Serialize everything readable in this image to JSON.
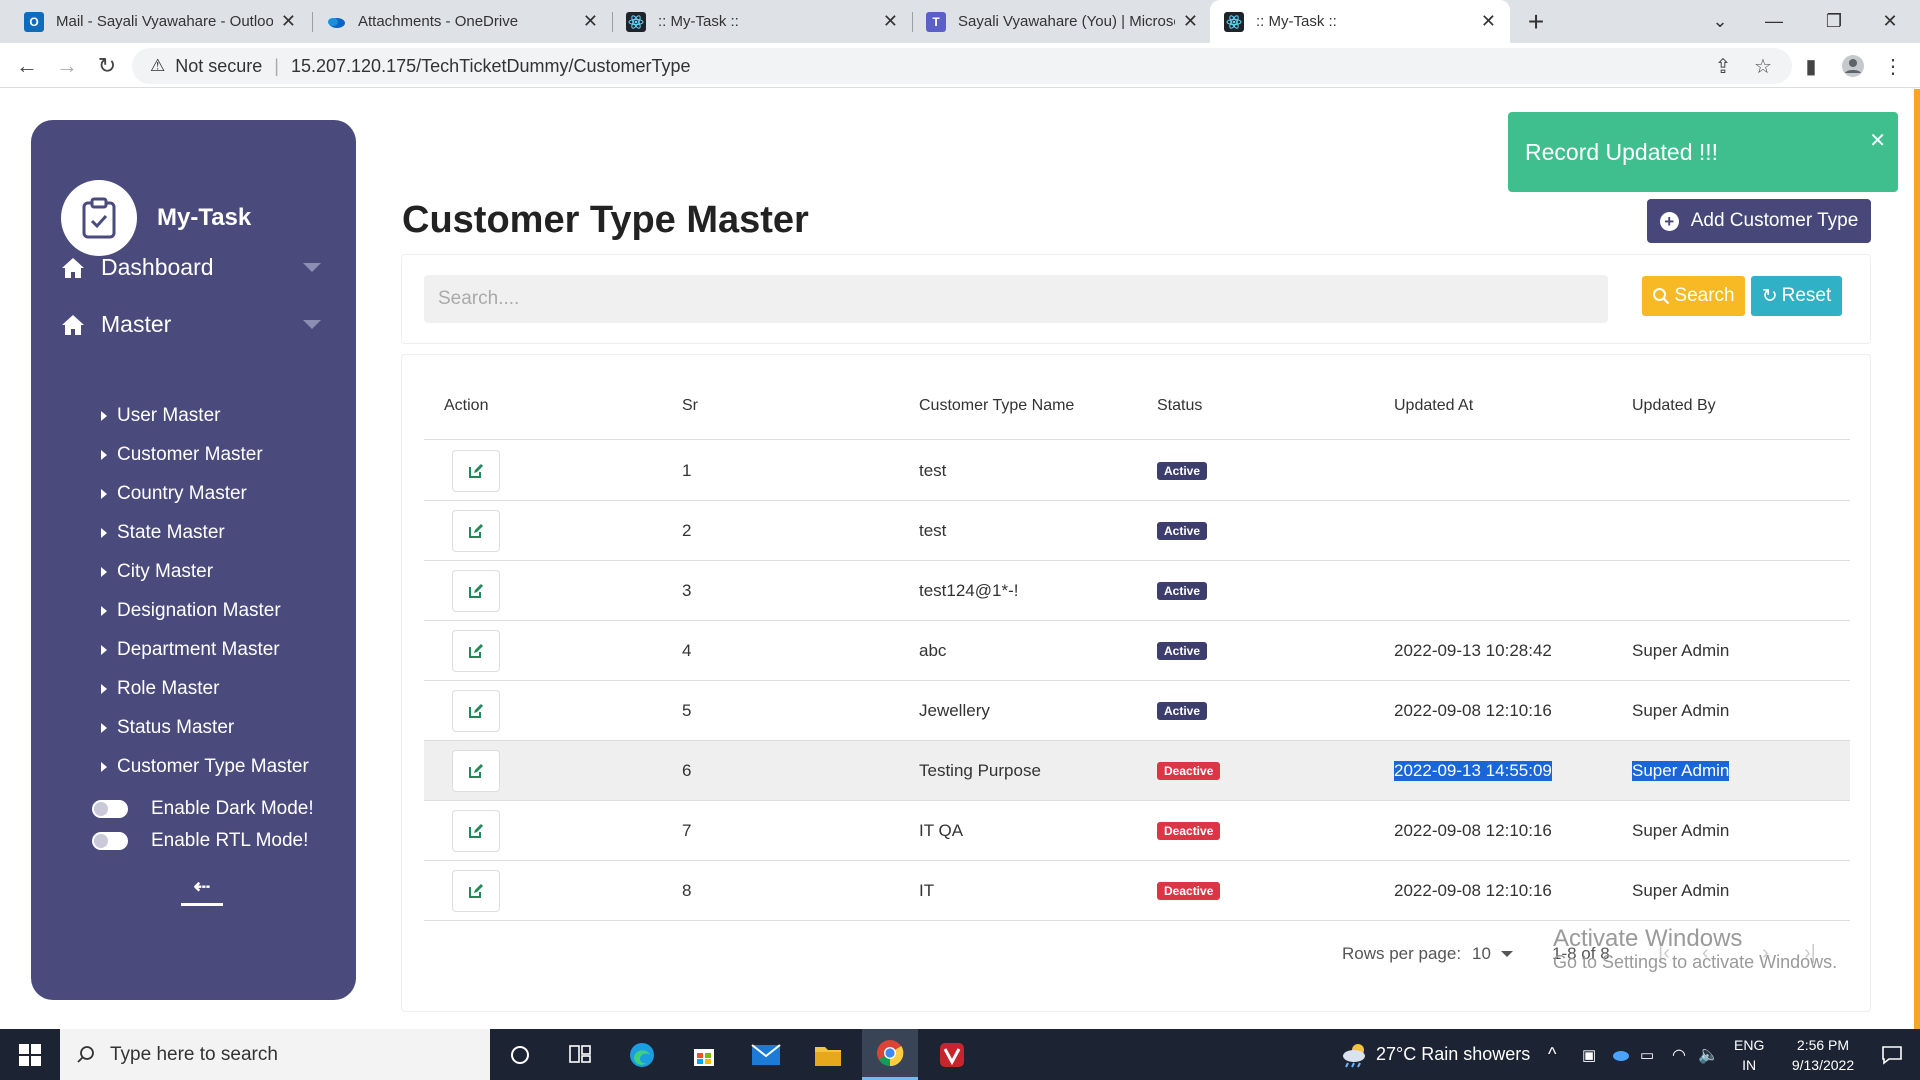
{
  "browser": {
    "tabs": [
      {
        "title": "Mail - Sayali Vyawahare - Outlook",
        "icon": "outlook-icon",
        "color": "#0f6cbd"
      },
      {
        "title": "Attachments - OneDrive",
        "icon": "onedrive-icon",
        "color": "#0a64c8"
      },
      {
        "title": ":: My-Task ::",
        "icon": "react-icon",
        "color": "#20232a"
      },
      {
        "title": "Sayali Vyawahare (You) | Microsoft Teams",
        "icon": "teams-icon",
        "color": "#5b5fc7"
      },
      {
        "title": ":: My-Task ::",
        "icon": "react-icon",
        "color": "#20232a"
      }
    ],
    "active_tab": 4,
    "security": "Not secure",
    "url": "15.207.120.175/TechTicketDummy/CustomerType"
  },
  "sidebar": {
    "brand": "My-Task",
    "nav": [
      {
        "label": "Dashboard",
        "icon": "home-icon"
      },
      {
        "label": "Master",
        "icon": "home-icon"
      }
    ],
    "sub_items": [
      "User Master",
      "Customer Master",
      "Country Master",
      "State Master",
      "City Master",
      "Designation Master",
      "Department Master",
      "Role Master",
      "Status Master",
      "Customer Type Master"
    ],
    "toggles": [
      "Enable Dark Mode!",
      "Enable RTL Mode!"
    ]
  },
  "page": {
    "title": "Customer Type Master",
    "add_button": "Add Customer Type",
    "toast": "Record Updated !!!",
    "search": {
      "placeholder": "Search....",
      "value": "",
      "search_label": "Search",
      "reset_label": "Reset"
    },
    "colors": {
      "accent": "#47477a",
      "search": "#f7b924",
      "reset": "#30b1c5",
      "success": "#3fbf8e",
      "danger": "#dc3545"
    }
  },
  "table": {
    "headers": [
      "Action",
      "Sr",
      "Customer Type Name",
      "Status",
      "Updated At",
      "Updated By"
    ],
    "rows": [
      {
        "sr": "1",
        "name": "test",
        "status": "Active",
        "updated_at": "",
        "updated_by": ""
      },
      {
        "sr": "2",
        "name": "test",
        "status": "Active",
        "updated_at": "",
        "updated_by": ""
      },
      {
        "sr": "3",
        "name": "test124@1*-!",
        "status": "Active",
        "updated_at": "",
        "updated_by": ""
      },
      {
        "sr": "4",
        "name": "abc",
        "status": "Active",
        "updated_at": "2022-09-13 10:28:42",
        "updated_by": "Super Admin"
      },
      {
        "sr": "5",
        "name": "Jewellery",
        "status": "Active",
        "updated_at": "2022-09-08 12:10:16",
        "updated_by": "Super Admin"
      },
      {
        "sr": "6",
        "name": "Testing Purpose",
        "status": "Deactive",
        "updated_at": "2022-09-13 14:55:09",
        "updated_by": "Super Admin"
      },
      {
        "sr": "7",
        "name": "IT QA",
        "status": "Deactive",
        "updated_at": "2022-09-08 12:10:16",
        "updated_by": "Super Admin"
      },
      {
        "sr": "8",
        "name": "IT",
        "status": "Deactive",
        "updated_at": "2022-09-08 12:10:16",
        "updated_by": "Super Admin"
      }
    ],
    "highlighted_row": 5,
    "pagination": {
      "rows_per_page_label": "Rows per page:",
      "rows_per_page": "10",
      "range": "1-8 of 8"
    }
  },
  "watermark": {
    "line1": "Activate Windows",
    "line2": "Go to Settings to activate Windows."
  },
  "taskbar": {
    "search_placeholder": "Type here to search",
    "weather": "27°C  Rain showers",
    "lang1": "ENG",
    "lang2": "IN",
    "time": "2:56 PM",
    "date": "9/13/2022"
  }
}
